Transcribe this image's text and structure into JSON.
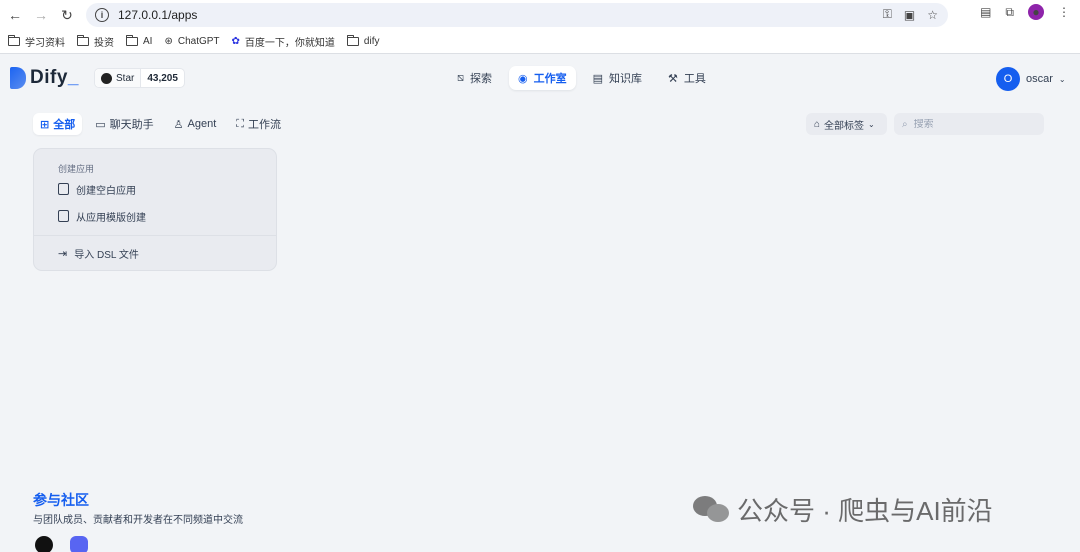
{
  "browser": {
    "url": "127.0.0.1/apps",
    "bookmarks": [
      {
        "label": "学习资料",
        "icon": "folder-icon"
      },
      {
        "label": "投资",
        "icon": "folder-icon"
      },
      {
        "label": "AI",
        "icon": "folder-icon"
      },
      {
        "label": "ChatGPT",
        "icon": "chatgpt-icon"
      },
      {
        "label": "百度一下，你就知道",
        "icon": "baidu-icon"
      },
      {
        "label": "dify",
        "icon": "folder-icon"
      }
    ]
  },
  "header": {
    "logo_text": "Dify",
    "logo_suffix": "_",
    "github_star_label": "Star",
    "github_star_count": "43,205",
    "nav": [
      {
        "label": "探索",
        "icon": "explore-icon"
      },
      {
        "label": "工作室",
        "icon": "robot-icon",
        "active": true
      },
      {
        "label": "知识库",
        "icon": "book-icon"
      },
      {
        "label": "工具",
        "icon": "hammer-icon"
      }
    ],
    "user_initial": "O",
    "user_name": "oscar"
  },
  "filters": {
    "tabs": [
      {
        "label": "全部",
        "icon": "grid-icon",
        "active": true
      },
      {
        "label": "聊天助手",
        "icon": "chat-icon"
      },
      {
        "label": "Agent",
        "icon": "agent-icon"
      },
      {
        "label": "工作流",
        "icon": "workflow-icon"
      }
    ],
    "tag_filter_label": "全部标签",
    "search_placeholder": "搜索"
  },
  "create_card": {
    "title": "创建应用",
    "actions": [
      "创建空白应用",
      "从应用模版创建"
    ],
    "import_label": "导入 DSL 文件"
  },
  "footer": {
    "community_title": "参与社区",
    "community_subtitle": "与团队成员、贡献者和开发者在不同频道中交流"
  },
  "watermark": {
    "text": "公众号 · 爬虫与AI前沿"
  },
  "colors": {
    "accent": "#155eef",
    "page_bg": "#f2f4f7"
  }
}
